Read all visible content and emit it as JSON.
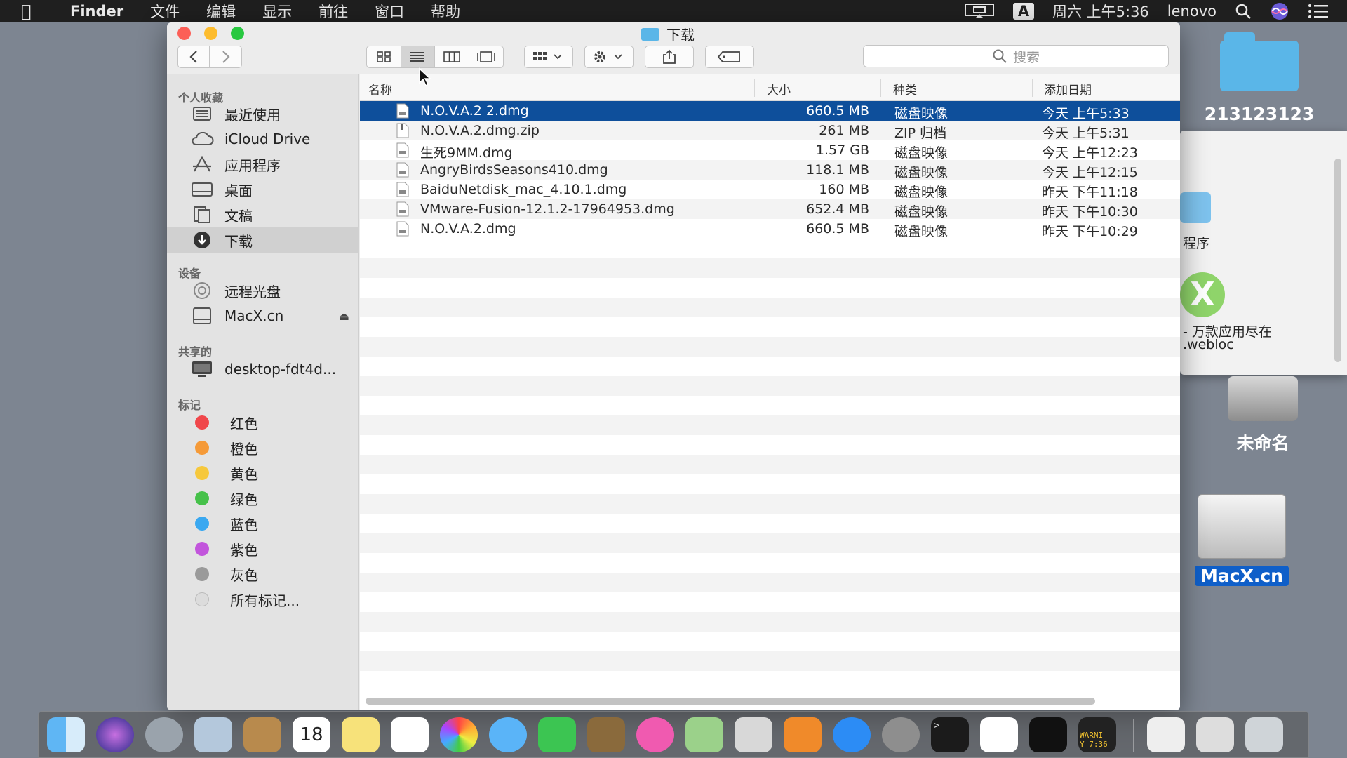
{
  "menubar": {
    "app": "Finder",
    "menus": [
      "文件",
      "编辑",
      "显示",
      "前往",
      "窗口",
      "帮助"
    ],
    "input_method": "A",
    "clock": "周六 上午5:36",
    "user": "lenovo"
  },
  "window": {
    "title": "下载",
    "search_placeholder": "搜索"
  },
  "sidebar": {
    "favorites_header": "个人收藏",
    "favorites": [
      {
        "label": "最近使用",
        "icon": "recents-icon"
      },
      {
        "label": "iCloud Drive",
        "icon": "icloud-icon"
      },
      {
        "label": "应用程序",
        "icon": "applications-icon"
      },
      {
        "label": "桌面",
        "icon": "desktop-icon"
      },
      {
        "label": "文稿",
        "icon": "documents-icon"
      },
      {
        "label": "下载",
        "icon": "downloads-icon",
        "selected": true
      }
    ],
    "devices_header": "设备",
    "devices": [
      {
        "label": "远程光盘",
        "icon": "remote-disc-icon"
      },
      {
        "label": "MacX.cn",
        "icon": "disk-icon"
      }
    ],
    "shared_header": "共享的",
    "shared": [
      {
        "label": "desktop-fdt4d...",
        "icon": "computer-icon"
      }
    ],
    "tags_header": "标记",
    "tags": [
      {
        "label": "红色",
        "color": "#f0474b"
      },
      {
        "label": "橙色",
        "color": "#f59a38"
      },
      {
        "label": "黄色",
        "color": "#f6c83c"
      },
      {
        "label": "绿色",
        "color": "#46c14a"
      },
      {
        "label": "蓝色",
        "color": "#3aa8f0"
      },
      {
        "label": "紫色",
        "color": "#c255dc"
      },
      {
        "label": "灰色",
        "color": "#9a9a9a"
      },
      {
        "label": "所有标记...",
        "color": "#dcdcdc"
      }
    ]
  },
  "columns": {
    "name": "名称",
    "size": "大小",
    "kind": "种类",
    "date": "添加日期"
  },
  "files": [
    {
      "name": "N.O.V.A.2 2.dmg",
      "size": "660.5 MB",
      "kind": "磁盘映像",
      "date": "今天 上午5:33",
      "selected": true
    },
    {
      "name": "N.O.V.A.2.dmg.zip",
      "size": "261 MB",
      "kind": "ZIP 归档",
      "date": "今天 上午5:31"
    },
    {
      "name": "生死9MM.dmg",
      "size": "1.57 GB",
      "kind": "磁盘映像",
      "date": "今天 上午12:23"
    },
    {
      "name": "AngryBirdsSeasons410.dmg",
      "size": "118.1 MB",
      "kind": "磁盘映像",
      "date": "今天 上午12:15"
    },
    {
      "name": "BaiduNetdisk_mac_4.10.1.dmg",
      "size": "160 MB",
      "kind": "磁盘映像",
      "date": "昨天 下午11:18"
    },
    {
      "name": "VMware-Fusion-12.1.2-17964953.dmg",
      "size": "652.4 MB",
      "kind": "磁盘映像",
      "date": "昨天 下午10:30"
    },
    {
      "name": "N.O.V.A.2.dmg",
      "size": "660.5 MB",
      "kind": "磁盘映像",
      "date": "昨天 下午10:29"
    }
  ],
  "desktop": {
    "folder_label": "213123123",
    "panel_text_1": "程序",
    "panel_text_2": "- 万款应用尽在",
    "panel_text_3": ".webloc",
    "drive_label": "未命名",
    "disk_label": "MacX.cn"
  },
  "dock": {
    "calendar_day": "18",
    "console_text": "WARNI\nY 7:36"
  }
}
